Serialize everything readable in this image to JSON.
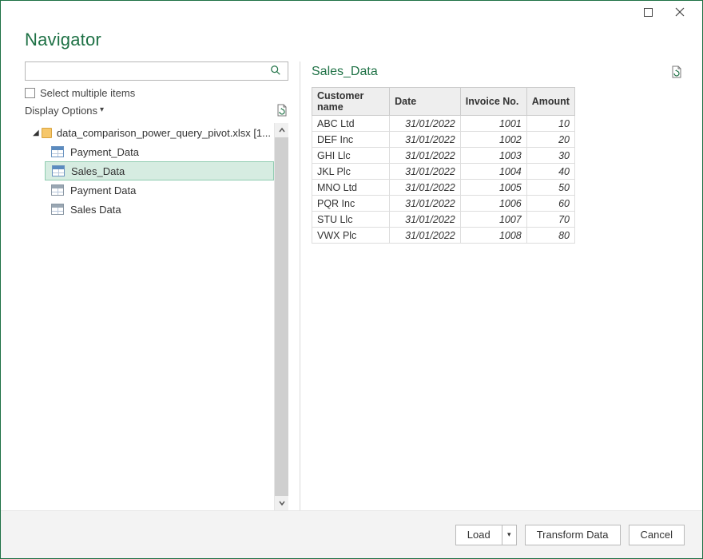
{
  "window": {
    "title": "Navigator"
  },
  "left": {
    "search_placeholder": "",
    "multi_items_label": "Select multiple items",
    "display_options_label": "Display Options",
    "file_label": "data_comparison_power_query_pivot.xlsx [1...",
    "items": [
      {
        "label": "Payment_Data",
        "kind": "table",
        "selected": false
      },
      {
        "label": "Sales_Data",
        "kind": "table",
        "selected": true
      },
      {
        "label": "Payment Data",
        "kind": "sheet",
        "selected": false
      },
      {
        "label": "Sales Data",
        "kind": "sheet",
        "selected": false
      }
    ]
  },
  "preview": {
    "title": "Sales_Data",
    "columns": [
      "Customer name",
      "Date",
      "Invoice No.",
      "Amount"
    ],
    "rows": [
      {
        "customer": "ABC Ltd",
        "date": "31/01/2022",
        "invoice": 1001,
        "amount": 10
      },
      {
        "customer": "DEF Inc",
        "date": "31/01/2022",
        "invoice": 1002,
        "amount": 20
      },
      {
        "customer": "GHI Llc",
        "date": "31/01/2022",
        "invoice": 1003,
        "amount": 30
      },
      {
        "customer": "JKL Plc",
        "date": "31/01/2022",
        "invoice": 1004,
        "amount": 40
      },
      {
        "customer": "MNO Ltd",
        "date": "31/01/2022",
        "invoice": 1005,
        "amount": 50
      },
      {
        "customer": "PQR Inc",
        "date": "31/01/2022",
        "invoice": 1006,
        "amount": 60
      },
      {
        "customer": "STU Llc",
        "date": "31/01/2022",
        "invoice": 1007,
        "amount": 70
      },
      {
        "customer": "VWX Plc",
        "date": "31/01/2022",
        "invoice": 1008,
        "amount": 80
      }
    ]
  },
  "footer": {
    "load_label": "Load",
    "transform_label": "Transform Data",
    "cancel_label": "Cancel"
  }
}
